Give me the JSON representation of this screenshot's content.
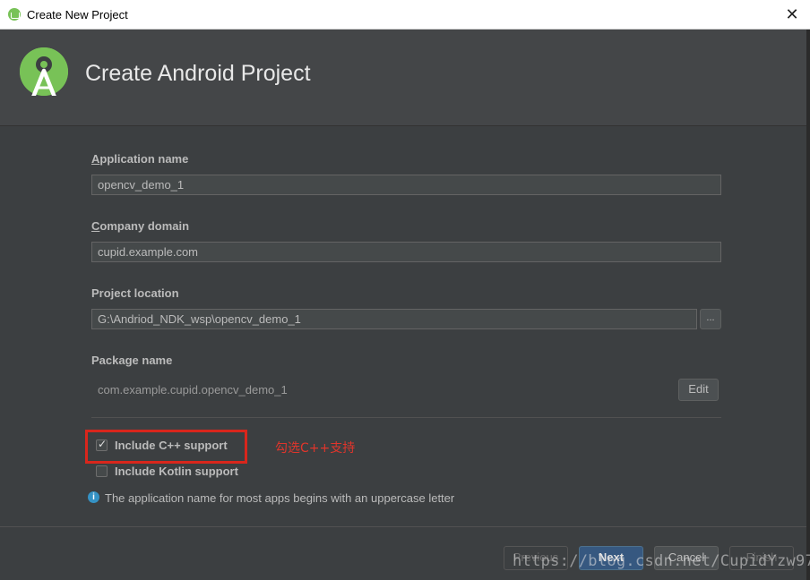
{
  "window": {
    "title": "Create New Project",
    "close_glyph": "✕"
  },
  "header": {
    "heading": "Create Android Project",
    "logo_icon": "android-studio-logo"
  },
  "form": {
    "app_name": {
      "label_first": "A",
      "label_rest": "pplication name",
      "value": "opencv_demo_1"
    },
    "company_domain": {
      "label_first": "C",
      "label_rest": "ompany domain",
      "value": "cupid.example.com"
    },
    "project_location": {
      "label": "Project location",
      "value": "G:\\Andriod_NDK_wsp\\opencv_demo_1",
      "browse_label": "..."
    },
    "package_name": {
      "label": "Package name",
      "value": "com.example.cupid.opencv_demo_1",
      "edit_label": "Edit"
    }
  },
  "options": [
    {
      "label": "Include C++ support",
      "checked": true
    },
    {
      "label": "Include Kotlin support",
      "checked": false
    }
  ],
  "annotation": {
    "text": "勾选C++支持",
    "color": "#e0352b"
  },
  "info": {
    "icon": "info-icon",
    "text": "The application name for most apps begins with an uppercase letter"
  },
  "footer": {
    "previous_label": "Previous",
    "next_label": "Next",
    "cancel_label": "Cancel",
    "finish_label": "Finish"
  },
  "watermark": "https://blog.csdn.net/CupidYzw97",
  "colors": {
    "accent": "#78c257",
    "primary_button": "#365880",
    "highlight": "#d9261c"
  }
}
